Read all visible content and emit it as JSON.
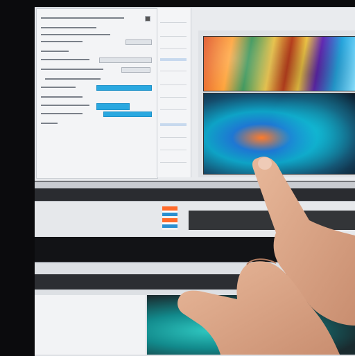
{
  "scene": {
    "subject_icon": "pointing-hand-icon",
    "screen_accent": "#2aa8e0",
    "settings_rows": 14
  }
}
